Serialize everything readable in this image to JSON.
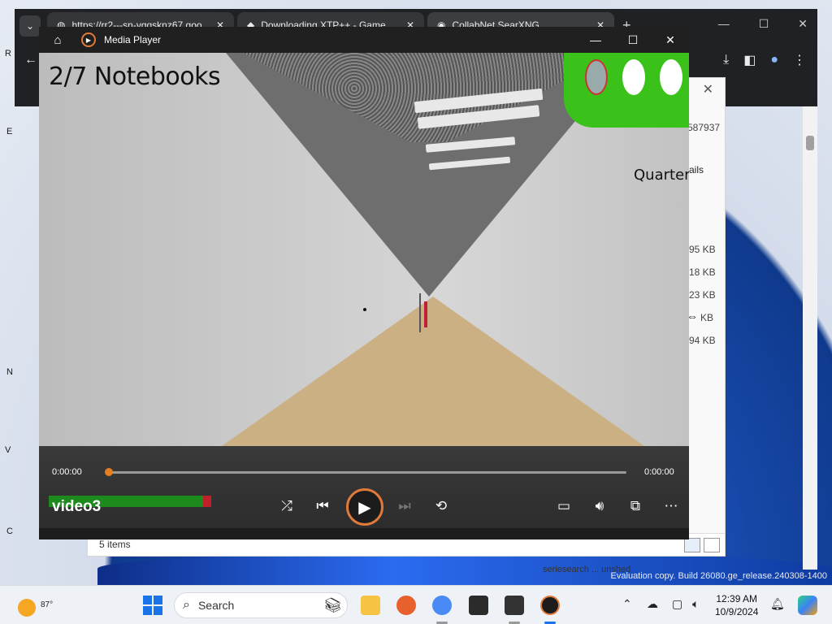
{
  "browser": {
    "tabs": [
      {
        "label": "https://rr2---sn-vgqsknz67.goo",
        "close": "✕"
      },
      {
        "label": "Downloading XTP++ - Game",
        "close": "✕"
      },
      {
        "label": "CollabNet SearXNG",
        "close": "✕"
      }
    ],
    "new_tab": "+",
    "window": {
      "minimize": "—",
      "maximize": "☐",
      "close": "✕"
    }
  },
  "file_pane": {
    "close": "✕",
    "id_fragment": "587937",
    "details_fragment": "ails",
    "sizes": [
      "95 KB",
      "18 KB",
      "23 KB",
      "KB",
      "94 KB"
    ],
    "status": "5 items"
  },
  "desktop": {
    "evaluation_line": "Evaluation copy. Build 26080.ge_release.240308-1400",
    "bottom_fragment": "seriesearch ... unshed"
  },
  "player": {
    "app_title": "Media Player",
    "window": {
      "minimize": "—",
      "maximize": "☐",
      "close": "✕"
    },
    "video": {
      "hud_counter": "2/7 Notebooks",
      "hud_item": "Quarter"
    },
    "time_elapsed": "0:00:00",
    "time_total": "0:00:00",
    "progress": 0,
    "media_title": "video3",
    "accent_color": "#e07a3a"
  },
  "taskbar": {
    "weather_temp": "87°",
    "search_placeholder": "Search",
    "time": "12:39 AM",
    "date": "10/9/2024"
  }
}
